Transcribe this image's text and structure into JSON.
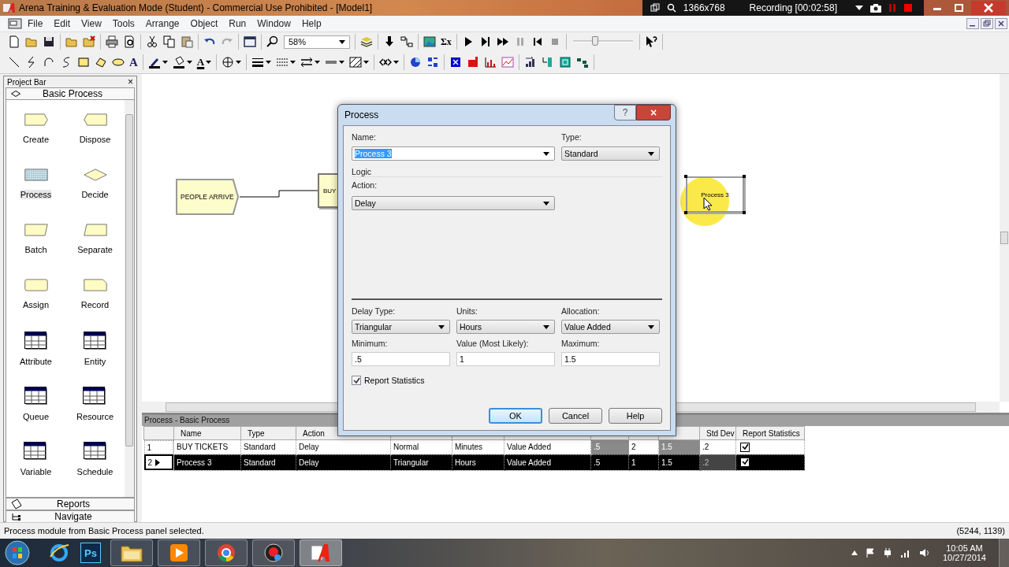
{
  "window": {
    "title": "Arena Training & Evaluation Mode (Student) - Commercial Use Prohibited - [Model1]"
  },
  "recorder": {
    "resolution": "1366x768",
    "status": "Recording [00:02:58]"
  },
  "menu": [
    "File",
    "Edit",
    "View",
    "Tools",
    "Arrange",
    "Object",
    "Run",
    "Window",
    "Help"
  ],
  "toolbar": {
    "zoom": "58%",
    "speed_slider": {
      "level": 0.35
    },
    "sum_glyph": "Σx",
    "text_tool_glyph": "A",
    "font_color_glyph": "A"
  },
  "project_bar": {
    "title": "Project Bar",
    "close": "×",
    "panel": "Basic Process",
    "modules": [
      {
        "label": "Create",
        "kind": "create",
        "selected": false
      },
      {
        "label": "Dispose",
        "kind": "dispose",
        "selected": false
      },
      {
        "label": "Process",
        "kind": "process",
        "selected": true
      },
      {
        "label": "Decide",
        "kind": "decide",
        "selected": false
      },
      {
        "label": "Batch",
        "kind": "batch",
        "selected": false
      },
      {
        "label": "Separate",
        "kind": "separate",
        "selected": false
      },
      {
        "label": "Assign",
        "kind": "assign",
        "selected": false
      },
      {
        "label": "Record",
        "kind": "record",
        "selected": false
      },
      {
        "label": "Attribute",
        "kind": "data",
        "selected": false
      },
      {
        "label": "Entity",
        "kind": "data",
        "selected": false
      },
      {
        "label": "Queue",
        "kind": "data",
        "selected": false
      },
      {
        "label": "Resource",
        "kind": "data",
        "selected": false
      },
      {
        "label": "Variable",
        "kind": "data",
        "selected": false
      },
      {
        "label": "Schedule",
        "kind": "data",
        "selected": false
      }
    ],
    "panels": [
      {
        "label": "Reports",
        "kind": "reports"
      },
      {
        "label": "Navigate",
        "kind": "navigate"
      }
    ]
  },
  "canvas": {
    "modules": [
      {
        "label": "PEOPLE ARRIVE",
        "kind": "create",
        "selected": false
      },
      {
        "label": "BUY",
        "kind": "process",
        "selected": false
      },
      {
        "label": "Process 3",
        "kind": "process",
        "selected": true
      }
    ]
  },
  "spreadsheet": {
    "title": "Process - Basic Process",
    "columns": [
      "Name",
      "Type",
      "Action",
      "",
      "",
      "",
      "",
      "",
      "",
      "Std Dev",
      "Report Statistics"
    ],
    "rows": [
      {
        "number": "1",
        "current": false,
        "selected": false,
        "report_statistics": true,
        "cells": [
          {
            "text": "BUY TICKETS",
            "disabled": false
          },
          {
            "text": "Standard",
            "disabled": false
          },
          {
            "text": "Delay",
            "disabled": false
          },
          {
            "text": "Normal",
            "disabled": false
          },
          {
            "text": "Minutes",
            "disabled": false
          },
          {
            "text": "Value Added",
            "disabled": false
          },
          {
            "text": ".5",
            "disabled": true
          },
          {
            "text": "2",
            "disabled": false
          },
          {
            "text": "1.5",
            "disabled": true
          },
          {
            "text": ".2",
            "disabled": false
          }
        ]
      },
      {
        "number": "2",
        "current": true,
        "selected": true,
        "report_statistics": true,
        "cells": [
          {
            "text": "Process 3",
            "disabled": false
          },
          {
            "text": "Standard",
            "disabled": false
          },
          {
            "text": "Delay",
            "disabled": false
          },
          {
            "text": "Triangular",
            "disabled": false
          },
          {
            "text": "Hours",
            "disabled": false
          },
          {
            "text": "Value Added",
            "disabled": false
          },
          {
            "text": ".5",
            "disabled": false
          },
          {
            "text": "1",
            "disabled": false
          },
          {
            "text": "1.5",
            "disabled": false
          },
          {
            "text": ".2",
            "disabled": true
          }
        ]
      }
    ]
  },
  "dialog": {
    "title": "Process",
    "help": "?",
    "close": "×",
    "name_label": "Name:",
    "name_value": "Process 3",
    "name_selected": true,
    "type_label": "Type:",
    "type_value": "Standard",
    "logic_label": "Logic",
    "action_label": "Action:",
    "action_value": "Delay",
    "combos": [
      {
        "label": "Delay Type:",
        "value": "Triangular"
      },
      {
        "label": "Units:",
        "value": "Hours"
      },
      {
        "label": "Allocation:",
        "value": "Value Added"
      }
    ],
    "inputs": [
      {
        "label": "Minimum:",
        "value": ".5"
      },
      {
        "label": "Value (Most Likely):",
        "value": "1"
      },
      {
        "label": "Maximum:",
        "value": "1.5"
      }
    ],
    "report_statistics": {
      "label": "Report Statistics",
      "checked": true
    },
    "buttons": [
      {
        "label": "OK",
        "default": true
      },
      {
        "label": "Cancel",
        "default": false
      },
      {
        "label": "Help",
        "default": false
      }
    ]
  },
  "status_bar": {
    "message": "Process module from Basic Process panel selected.",
    "coordinates": "(5244, 1139)"
  },
  "taskbar": {
    "apps": [
      {
        "kind": "explorer"
      },
      {
        "kind": "photoshop",
        "label": "Ps"
      },
      {
        "kind": "folder"
      },
      {
        "kind": "media"
      },
      {
        "kind": "chrome"
      },
      {
        "kind": "recorder"
      },
      {
        "kind": "arena"
      }
    ],
    "time": "10:05 AM",
    "date": "10/27/2014"
  }
}
